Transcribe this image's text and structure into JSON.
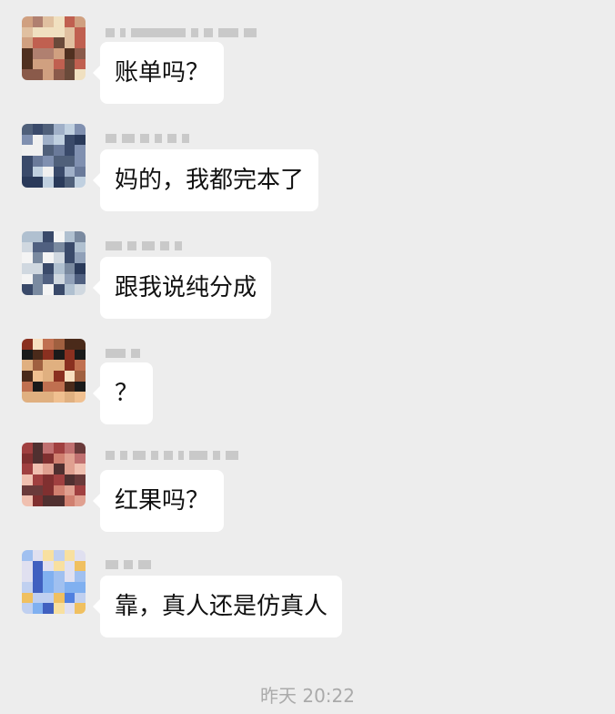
{
  "chat": {
    "messages": [
      {
        "text": "账单吗？",
        "avatar_palette": [
          "#6a4a3a",
          "#b08070",
          "#d0a080",
          "#f0e0c0",
          "#8a5a4a",
          "#c06050",
          "#503020",
          "#e0c0a0"
        ]
      },
      {
        "text": "妈的，我都完本了",
        "avatar_palette": [
          "#3a4a6a",
          "#6a7a9a",
          "#c0d0e0",
          "#f0f0f0",
          "#50607a",
          "#8090b0",
          "#2a3a5a",
          "#a0b0c8"
        ]
      },
      {
        "text": "跟我说纯分成",
        "avatar_palette": [
          "#3a4a6a",
          "#7a8aa0",
          "#d0d8e0",
          "#f4f4f4",
          "#506080",
          "#90a0b8",
          "#2a3a5a",
          "#b0c0d0"
        ]
      },
      {
        "text": "？",
        "avatar_palette": [
          "#1a1a1a",
          "#8a3020",
          "#f0c090",
          "#e0b080",
          "#4a2a1a",
          "#c07050",
          "#f8e0c0",
          "#a06040"
        ]
      },
      {
        "text": "红果吗？",
        "avatar_palette": [
          "#6a3a3a",
          "#c07070",
          "#e0a090",
          "#a04040",
          "#503030",
          "#f0c0b0",
          "#803030",
          "#d08070"
        ]
      },
      {
        "text": "靠，真人还是仿真人",
        "avatar_palette": [
          "#5080e0",
          "#80b0f0",
          "#f0c060",
          "#e0e0f0",
          "#4060c0",
          "#a0c0f0",
          "#f8e0a0",
          "#c0d0f0"
        ]
      }
    ],
    "timestamp": "昨天 20:22"
  }
}
